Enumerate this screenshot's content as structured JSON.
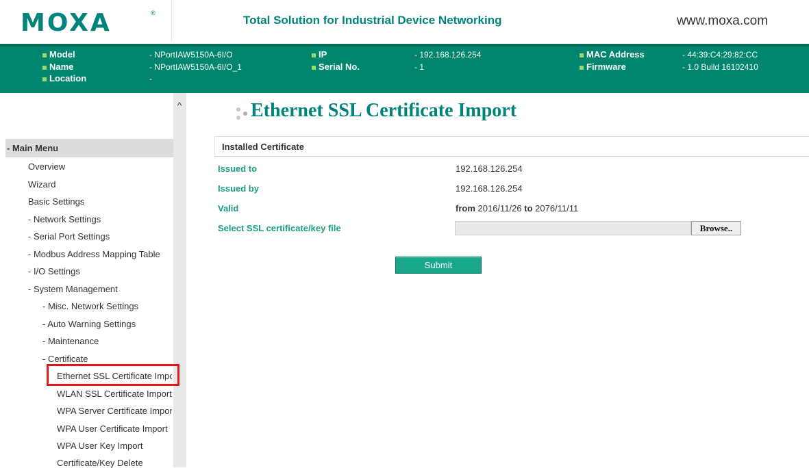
{
  "brand": {
    "logo": "MOXA",
    "registered_mark": "®",
    "tagline": "Total Solution for Industrial Device Networking",
    "url": "www.moxa.com"
  },
  "device_info": {
    "model_label": "Model",
    "model_value": "- NPortIAW5150A-6I/O",
    "name_label": "Name",
    "name_value": "- NPortIAW5150A-6I/O_1",
    "location_label": "Location",
    "location_value": "-",
    "ip_label": "IP",
    "ip_value": "- 192.168.126.254",
    "serial_label": "Serial No.",
    "serial_value": "- 1",
    "mac_label": "MAC Address",
    "mac_value": "- 44:39:C4:29:82:CC",
    "firmware_label": "Firmware",
    "firmware_value": "- 1.0 Build 16102410"
  },
  "sidebar": {
    "header": "- Main Menu",
    "items": [
      "Overview",
      "Wizard",
      "Basic Settings",
      "- Network Settings",
      "- Serial Port Settings",
      "- Modbus Address Mapping Table",
      "- I/O Settings",
      "- System Management",
      "- Misc. Network Settings",
      "- Auto Warning Settings",
      "- Maintenance",
      "- Certificate",
      "Ethernet SSL Certificate Import",
      "WLAN SSL Certificate Import",
      "WPA Server Certificate Import",
      "WPA User Certificate Import",
      "WPA User Key Import",
      "Certificate/Key Delete"
    ],
    "scroll_up_glyph": "^"
  },
  "main": {
    "title": "Ethernet SSL Certificate Import",
    "section": "Installed Certificate",
    "issued_to_label": "Issued to",
    "issued_to_value": "192.168.126.254",
    "issued_by_label": "Issued by",
    "issued_by_value": "192.168.126.254",
    "valid_label": "Valid",
    "valid_from_word": "from",
    "valid_from": "2016/11/26",
    "valid_to_word": "to",
    "valid_to": "2076/11/11",
    "select_label": "Select SSL certificate/key file",
    "file_value": "",
    "browse_label": "Browse..",
    "submit_label": "Submit"
  },
  "colors": {
    "brand_green": "#00837a",
    "info_band": "#00866f",
    "highlight_red": "#e0191b",
    "submit_green": "#1aa88c"
  }
}
